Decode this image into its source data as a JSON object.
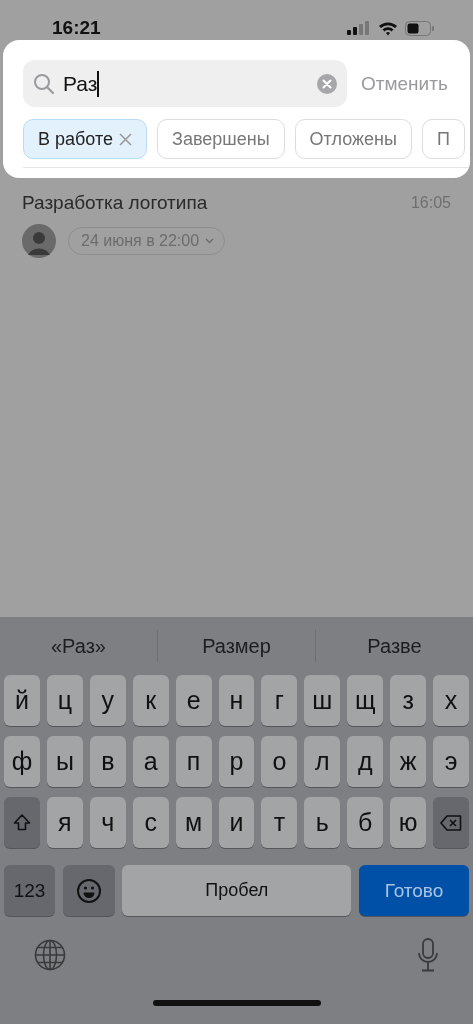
{
  "status_bar": {
    "time": "16:21"
  },
  "search": {
    "value": "Раз",
    "cancel": "Отменить"
  },
  "filters": [
    {
      "label": "В работе",
      "selected": true
    },
    {
      "label": "Завершены",
      "selected": false
    },
    {
      "label": "Отложены",
      "selected": false
    },
    {
      "label": "П",
      "selected": false
    }
  ],
  "tasks": [
    {
      "title": "Разработка логотипа",
      "time": "16:05",
      "due": "24 июня в 22:00"
    }
  ],
  "keyboard": {
    "suggestions": [
      "«Раз»",
      "Размер",
      "Разве"
    ],
    "rows": [
      [
        "й",
        "ц",
        "у",
        "к",
        "е",
        "н",
        "г",
        "ш",
        "щ",
        "з",
        "х"
      ],
      [
        "ф",
        "ы",
        "в",
        "а",
        "п",
        "р",
        "о",
        "л",
        "д",
        "ж",
        "э"
      ],
      [
        "",
        "я",
        "ч",
        "с",
        "м",
        "и",
        "т",
        "ь",
        "б",
        "ю",
        ""
      ]
    ],
    "numbers_key": "123",
    "space_key": "Пробел",
    "return_key": "Готово"
  }
}
